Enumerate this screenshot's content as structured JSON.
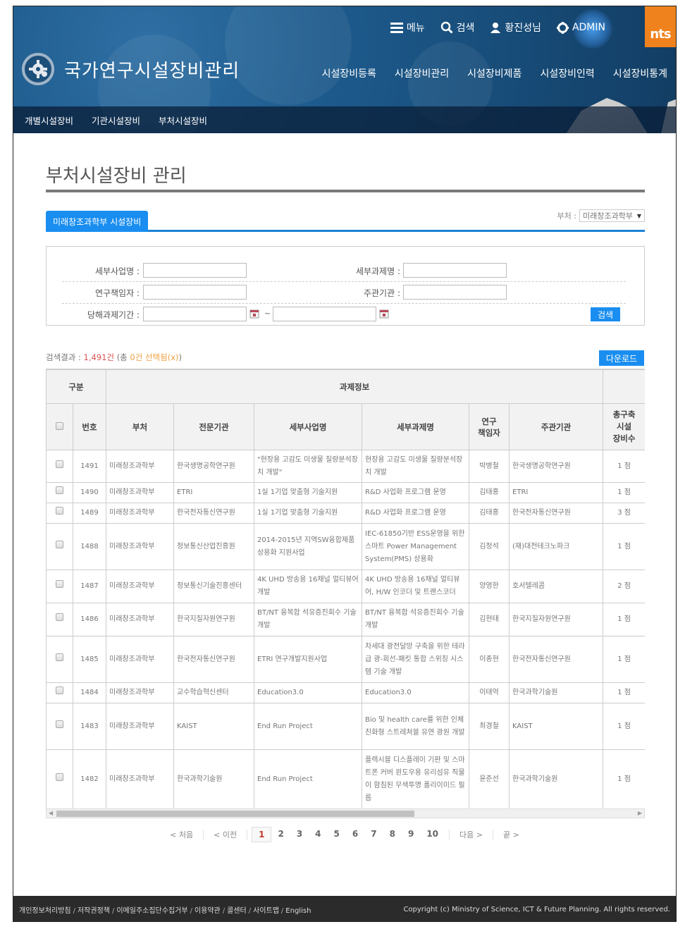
{
  "header": {
    "site_title": "국가연구시설장비관리",
    "util": {
      "menu": "메뉴",
      "search": "검색",
      "user": "황진성님",
      "admin": "ADMIN"
    },
    "agency_logo": "nts",
    "main_nav": [
      "시설장비등록",
      "시설장비관리",
      "시설장비제품",
      "시설장비인력",
      "시설장비통계"
    ],
    "sub_nav": [
      "개별시설장비",
      "기관시설장비",
      "부처시설장비"
    ]
  },
  "page": {
    "title": "부처시설장비 관리",
    "tab_active": "미래창조과학부 시설장비",
    "dept_filter_label": "부처 :",
    "dept_filter_value": "미래창조과학부"
  },
  "search": {
    "fields": {
      "subproject_name_label": "세부사업명 :",
      "subproject_name_value": "",
      "subtask_name_label": "세부과제명 :",
      "subtask_name_value": "",
      "researcher_label": "연구책임자 :",
      "researcher_value": "",
      "host_org_label": "주관기관 :",
      "host_org_value": "",
      "period_label": "당해과제기간 :",
      "period_start": "",
      "period_end": "",
      "period_separator": "~"
    },
    "button": "검색"
  },
  "results": {
    "label": "검색결과 :",
    "count": "1,491건",
    "selected_prefix": "(총",
    "selected": "0건 선택됨(x)",
    "selected_suffix": ")",
    "download_button": "다운로드"
  },
  "table": {
    "group_headers": [
      "구분",
      "과제정보",
      ""
    ],
    "headers": [
      "번호",
      "부처",
      "전문기관",
      "세부사업명",
      "세부과제명",
      "연구\n책임자",
      "주관기관",
      "총구축\n시설\n장비수"
    ],
    "rows": [
      {
        "no": "1491",
        "dept": "미래창조과학부",
        "agency": "한국생명공학연구원",
        "subproject": "\"현장용 고감도 미생물 질량분석장치 개발\"",
        "subtask": "현장용 고감도 미생물 질량분석장치 개발",
        "researcher": "박병철",
        "host": "한국생명공학연구원",
        "count": "1 점"
      },
      {
        "no": "1490",
        "dept": "미래창조과학부",
        "agency": "ETRI",
        "subproject": "1실 1기업 맞춤형 기술지원",
        "subtask": "R&D 사업화 프로그램 운영",
        "researcher": "김태홍",
        "host": "ETRI",
        "count": "1 점"
      },
      {
        "no": "1489",
        "dept": "미래창조과학부",
        "agency": "한국전자통신연구원",
        "subproject": "1실 1기업 맞춤형 기술지원",
        "subtask": "R&D 사업화 프로그램 운영",
        "researcher": "김태홍",
        "host": "한국전자통신연구원",
        "count": "3 점"
      },
      {
        "no": "1488",
        "dept": "미래창조과학부",
        "agency": "정보통신산업진흥원",
        "subproject": "2014-2015년 지역SW융합제품 상용화 지원사업",
        "subtask": "IEC-61850기반 ESS운영을 위한 스마트 Power Management System(PMS) 상용화",
        "researcher": "김정석",
        "host": "(재)대전테크노파크",
        "count": "1 점"
      },
      {
        "no": "1487",
        "dept": "미래창조과학부",
        "agency": "정보통신기술진흥센터",
        "subproject": "4K UHD 방송용 16채널 멀티뷰어 개발",
        "subtask": "4K UHD 방송용 16채널 멀티뷰어, H/W 인코더 및 트랜스코더",
        "researcher": "양영한",
        "host": "호서텔레콤",
        "count": "2 점"
      },
      {
        "no": "1486",
        "dept": "미래창조과학부",
        "agency": "한국지질자원연구원",
        "subproject": "BT/NT 융복합 석유증진회수 기술 개발",
        "subtask": "BT/NT 융복합 석유증진회수 기술 개발",
        "researcher": "김현태",
        "host": "한국지질자원연구원",
        "count": "1 점"
      },
      {
        "no": "1485",
        "dept": "미래창조과학부",
        "agency": "한국전자통신연구원",
        "subproject": "ETRI 연구개발지원사업",
        "subtask": "차세대 광전달망 구축을 위한 테라급 광-회선-패킷 통합 스위칭 시스템 기술 개발",
        "researcher": "이종현",
        "host": "한국전자통신연구원",
        "count": "1 점"
      },
      {
        "no": "1484",
        "dept": "미래창조과학부",
        "agency": "교수학습혁신센터",
        "subproject": "Education3.0",
        "subtask": "Education3.0",
        "researcher": "이태억",
        "host": "한국과학기술원",
        "count": "1 점"
      },
      {
        "no": "1483",
        "dept": "미래창조과학부",
        "agency": "KAIST",
        "subproject": "End Run Project",
        "subtask": "Bio 및 health care를 위한 인체친화형 스트레쳐블 유연 광원 개발",
        "researcher": "최경철",
        "host": "KAIST",
        "count": "1 점"
      },
      {
        "no": "1482",
        "dept": "미래창조과학부",
        "agency": "한국과학기술원",
        "subproject": "End Run Project",
        "subtask": "플렉시블 디스플레이 기판 및 스마트폰 커버 윈도우용 유리섬유 직물이 함침된 무색투명 폴리이미드 필름",
        "researcher": "윤준선",
        "host": "한국과학기술원",
        "count": "1 점"
      }
    ]
  },
  "pagination": {
    "first": "< 처음",
    "prev": "< 이전",
    "pages": [
      "1",
      "2",
      "3",
      "4",
      "5",
      "6",
      "7",
      "8",
      "9",
      "10"
    ],
    "current": "1",
    "next": "다음 >",
    "last": "끝 >"
  },
  "footer": {
    "links": [
      "개인정보처리방침",
      "저작권정책",
      "이메일주소집단수집거부",
      "이용약관",
      "콜센터",
      "사이트맵",
      "English"
    ],
    "copyright": "Copyright (c) Ministry of Science, ICT & Future Planning. All rights reserved."
  },
  "colors": {
    "accent": "#1a8ef0",
    "header_bg": "#1d5a8c",
    "agency_orange": "#f0821e",
    "count_red": "#d9534f",
    "selected_orange": "#f0a040",
    "footer_bg": "#2b2b2b"
  }
}
